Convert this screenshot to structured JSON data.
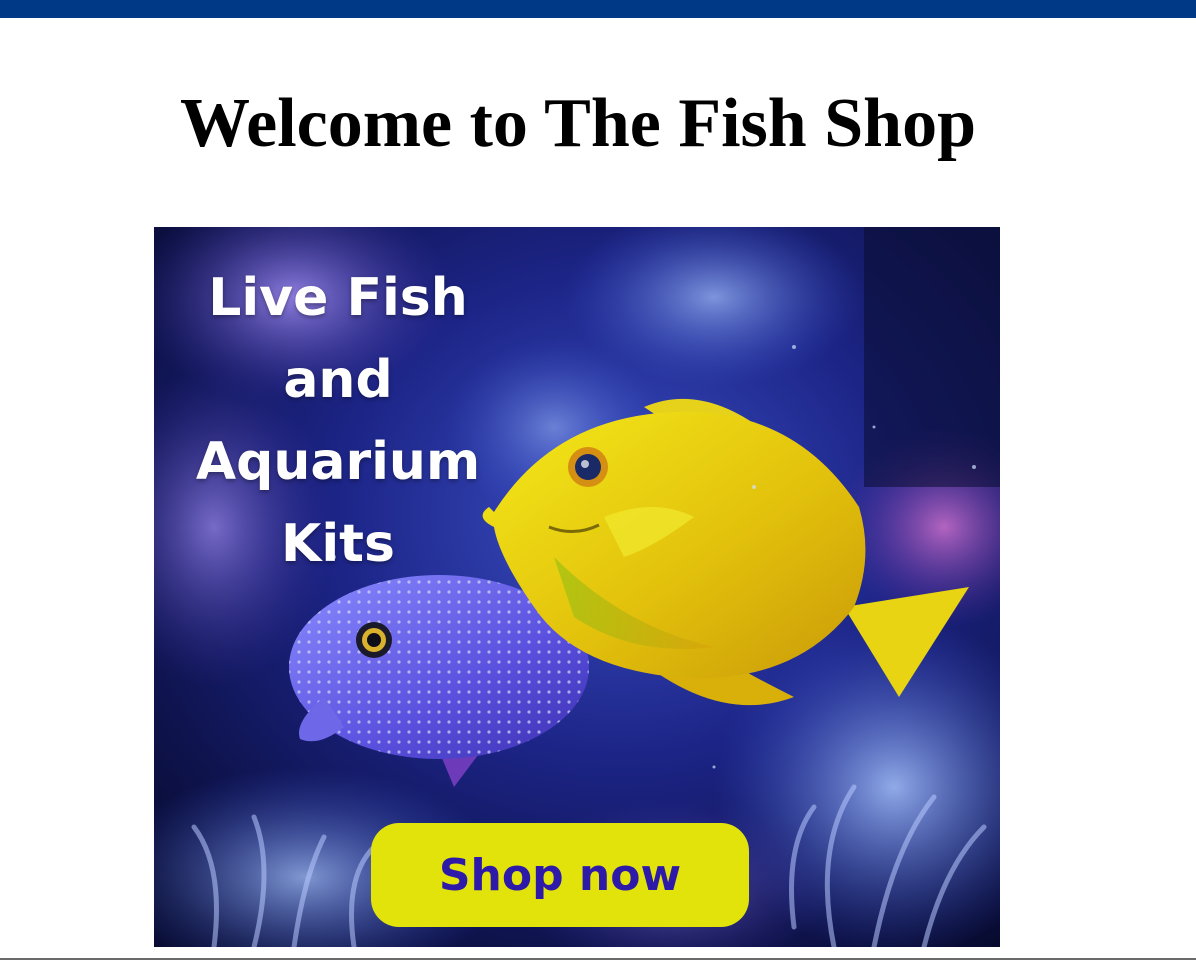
{
  "header": {
    "title": "Welcome to The Fish Shop",
    "bar_color": "#003a86"
  },
  "hero": {
    "heading": "Live Fish and Aquarium Kits",
    "image_description_icon": "fish-photo",
    "cta_label": "Shop now",
    "cta_background": "#e2e30b",
    "cta_text_color": "#2d1aa8"
  }
}
